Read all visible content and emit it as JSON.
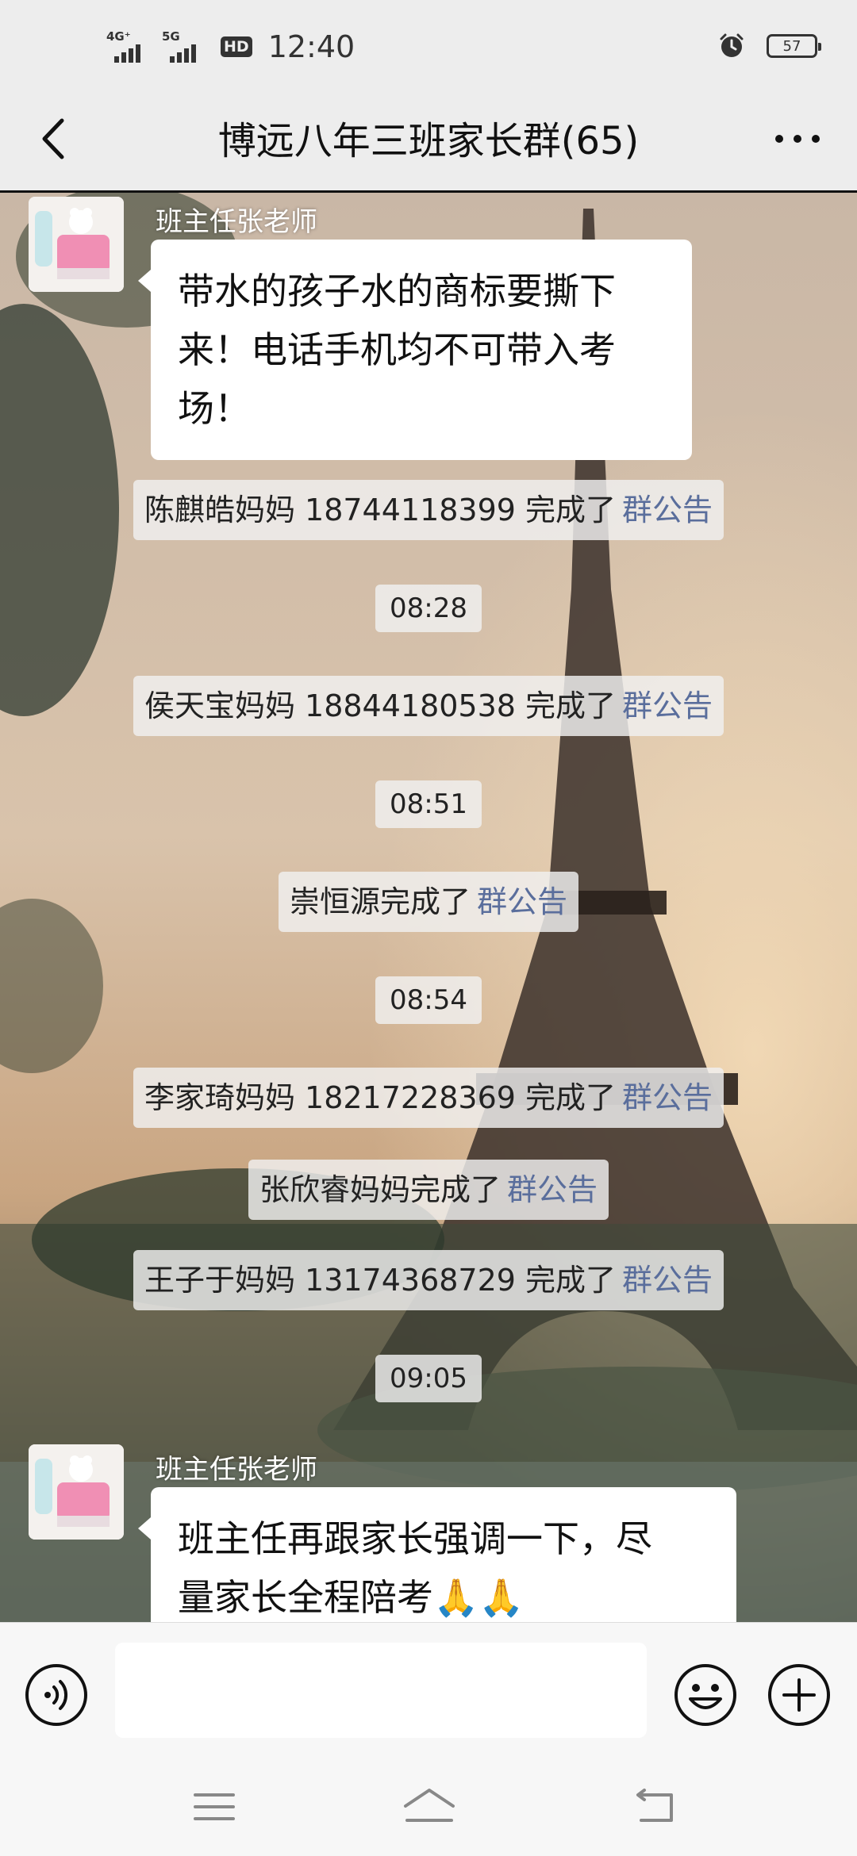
{
  "status_bar": {
    "network_1": "4G⁺",
    "network_2": "5G",
    "hd": "HD",
    "time": "12:40",
    "battery": "57"
  },
  "header": {
    "title": "博远八年三班家长群(65)"
  },
  "messages": {
    "m1": {
      "sender": "班主任张老师",
      "line1": "带水的孩子水的商标要撕下",
      "line2": "来！电话手机均不可带入考",
      "line3": "场！"
    },
    "s1": {
      "text": "陈麒皓妈妈  18744118399 完成了",
      "link": "群公告"
    },
    "t1": "08:28",
    "s2": {
      "text": "侯天宝妈妈 18844180538 完成了",
      "link": "群公告"
    },
    "t2": "08:51",
    "s3": {
      "text": "崇恒源完成了",
      "link": "群公告"
    },
    "t3": "08:54",
    "s4": {
      "text": "李家琦妈妈 18217228369 完成了",
      "link": "群公告"
    },
    "s5": {
      "text": "张欣睿妈妈完成了",
      "link": "群公告"
    },
    "s6": {
      "text": "王子于妈妈 13174368729 完成了",
      "link": "群公告"
    },
    "t4": "09:05",
    "m2": {
      "sender": "班主任张老师",
      "line1": "班主任再跟家长强调一下，尽",
      "line2": "量家长全程陪考🙏🙏"
    }
  },
  "input": {
    "value": "",
    "placeholder": ""
  },
  "icons": {
    "back": "chevron-left-icon",
    "more": "more-dots-icon",
    "voice": "voice-icon",
    "emoji": "emoji-icon",
    "plus": "plus-icon",
    "menu": "menu-icon",
    "home": "home-icon",
    "return": "return-icon",
    "alarm": "alarm-icon"
  },
  "colors": {
    "link": "#5a6e9c",
    "bar_bg": "#ededed"
  }
}
